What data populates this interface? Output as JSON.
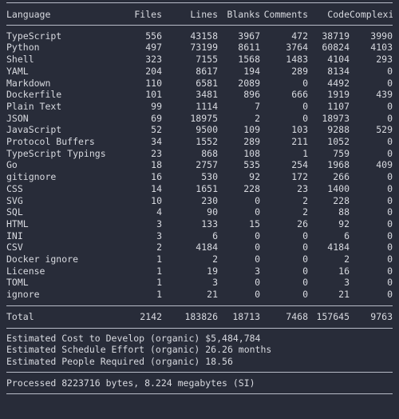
{
  "table": {
    "columns": [
      {
        "key": "language",
        "label": "Language",
        "align": "left"
      },
      {
        "key": "files",
        "label": "Files",
        "align": "right"
      },
      {
        "key": "lines",
        "label": "Lines",
        "align": "right"
      },
      {
        "key": "blanks",
        "label": "Blanks",
        "align": "right"
      },
      {
        "key": "comments",
        "label": "Comments",
        "align": "right"
      },
      {
        "key": "code",
        "label": "Code",
        "align": "right"
      },
      {
        "key": "complexity",
        "label": "Complexity",
        "align": "right"
      }
    ],
    "rows": [
      {
        "language": "TypeScript",
        "files": "556",
        "lines": "43158",
        "blanks": "3967",
        "comments": "472",
        "code": "38719",
        "complexity": "3990"
      },
      {
        "language": "Python",
        "files": "497",
        "lines": "73199",
        "blanks": "8611",
        "comments": "3764",
        "code": "60824",
        "complexity": "4103"
      },
      {
        "language": "Shell",
        "files": "323",
        "lines": "7155",
        "blanks": "1568",
        "comments": "1483",
        "code": "4104",
        "complexity": "293"
      },
      {
        "language": "YAML",
        "files": "204",
        "lines": "8617",
        "blanks": "194",
        "comments": "289",
        "code": "8134",
        "complexity": "0"
      },
      {
        "language": "Markdown",
        "files": "110",
        "lines": "6581",
        "blanks": "2089",
        "comments": "0",
        "code": "4492",
        "complexity": "0"
      },
      {
        "language": "Dockerfile",
        "files": "101",
        "lines": "3481",
        "blanks": "896",
        "comments": "666",
        "code": "1919",
        "complexity": "439"
      },
      {
        "language": "Plain Text",
        "files": "99",
        "lines": "1114",
        "blanks": "7",
        "comments": "0",
        "code": "1107",
        "complexity": "0"
      },
      {
        "language": "JSON",
        "files": "69",
        "lines": "18975",
        "blanks": "2",
        "comments": "0",
        "code": "18973",
        "complexity": "0"
      },
      {
        "language": "JavaScript",
        "files": "52",
        "lines": "9500",
        "blanks": "109",
        "comments": "103",
        "code": "9288",
        "complexity": "529"
      },
      {
        "language": "Protocol Buffers",
        "files": "34",
        "lines": "1552",
        "blanks": "289",
        "comments": "211",
        "code": "1052",
        "complexity": "0"
      },
      {
        "language": "TypeScript Typings",
        "files": "23",
        "lines": "868",
        "blanks": "108",
        "comments": "1",
        "code": "759",
        "complexity": "0"
      },
      {
        "language": "Go",
        "files": "18",
        "lines": "2757",
        "blanks": "535",
        "comments": "254",
        "code": "1968",
        "complexity": "409"
      },
      {
        "language": "gitignore",
        "files": "16",
        "lines": "530",
        "blanks": "92",
        "comments": "172",
        "code": "266",
        "complexity": "0"
      },
      {
        "language": "CSS",
        "files": "14",
        "lines": "1651",
        "blanks": "228",
        "comments": "23",
        "code": "1400",
        "complexity": "0"
      },
      {
        "language": "SVG",
        "files": "10",
        "lines": "230",
        "blanks": "0",
        "comments": "2",
        "code": "228",
        "complexity": "0"
      },
      {
        "language": "SQL",
        "files": "4",
        "lines": "90",
        "blanks": "0",
        "comments": "2",
        "code": "88",
        "complexity": "0"
      },
      {
        "language": "HTML",
        "files": "3",
        "lines": "133",
        "blanks": "15",
        "comments": "26",
        "code": "92",
        "complexity": "0"
      },
      {
        "language": "INI",
        "files": "3",
        "lines": "6",
        "blanks": "0",
        "comments": "0",
        "code": "6",
        "complexity": "0"
      },
      {
        "language": "CSV",
        "files": "2",
        "lines": "4184",
        "blanks": "0",
        "comments": "0",
        "code": "4184",
        "complexity": "0"
      },
      {
        "language": "Docker ignore",
        "files": "1",
        "lines": "2",
        "blanks": "0",
        "comments": "0",
        "code": "2",
        "complexity": "0"
      },
      {
        "language": "License",
        "files": "1",
        "lines": "19",
        "blanks": "3",
        "comments": "0",
        "code": "16",
        "complexity": "0"
      },
      {
        "language": "TOML",
        "files": "1",
        "lines": "3",
        "blanks": "0",
        "comments": "0",
        "code": "3",
        "complexity": "0"
      },
      {
        "language": "ignore",
        "files": "1",
        "lines": "21",
        "blanks": "0",
        "comments": "0",
        "code": "21",
        "complexity": "0"
      }
    ],
    "total": {
      "language": "Total",
      "files": "2142",
      "lines": "183826",
      "blanks": "18713",
      "comments": "7468",
      "code": "157645",
      "complexity": "9763"
    }
  },
  "estimates": {
    "cost": "Estimated Cost to Develop (organic) $5,484,784",
    "schedule": "Estimated Schedule Effort (organic) 26.26 months",
    "people": "Estimated People Required (organic) 18.56"
  },
  "processed": {
    "line": "Processed 8223716 bytes, 8.224 megabytes (SI)"
  },
  "colors": {
    "background": "#282c39",
    "text": "#d8dae0",
    "rule": "#b8bcc8"
  }
}
